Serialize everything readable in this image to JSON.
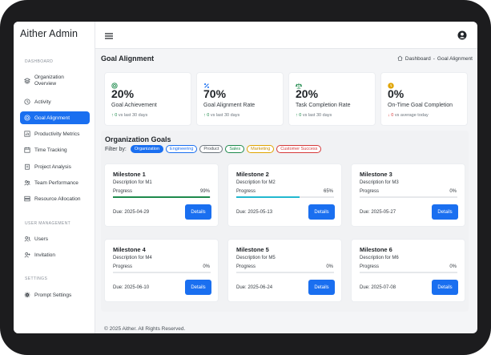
{
  "app": {
    "brand": "Aither Admin"
  },
  "sidebar": {
    "sections": [
      {
        "label": "DASHBOARD"
      },
      {
        "label": "USER MANAGEMENT"
      },
      {
        "label": "SETTINGS"
      }
    ],
    "items": [
      {
        "label": "Organization Overview",
        "icon": "layers-icon"
      },
      {
        "label": "Activity",
        "icon": "clock-icon"
      },
      {
        "label": "Goal Alignment",
        "icon": "target-icon",
        "active": true
      },
      {
        "label": "Productivity Metrics",
        "icon": "bar-chart-icon"
      },
      {
        "label": "Time Tracking",
        "icon": "calendar-icon"
      },
      {
        "label": "Project Analysis",
        "icon": "clipboard-icon"
      },
      {
        "label": "Team Performance",
        "icon": "team-icon"
      },
      {
        "label": "Resource Allocation",
        "icon": "server-icon"
      },
      {
        "label": "Users",
        "icon": "users-icon"
      },
      {
        "label": "Invitation",
        "icon": "user-plus-icon"
      },
      {
        "label": "Prompt Settings",
        "icon": "gear-icon"
      }
    ]
  },
  "header": {
    "menu_icon": "hamburger-icon",
    "user_icon": "user-circle-icon"
  },
  "main": {
    "title": "Goal Alignment",
    "breadcrumb": {
      "home": "Dashboard",
      "separator": "-",
      "current": "Goal Alignment"
    }
  },
  "kpis": [
    {
      "value": "20%",
      "label": "Goal Achievement",
      "trend": "up",
      "delta": "0",
      "sub": "vs last 30 days",
      "icon": "target-icon",
      "color": "#1e8a4c"
    },
    {
      "value": "70%",
      "label": "Goal Alignment Rate",
      "trend": "up",
      "delta": "0",
      "sub": "vs last 30 days",
      "icon": "percent-icon",
      "color": "#1a6ff0"
    },
    {
      "value": "20%",
      "label": "Task Completion Rate",
      "trend": "up",
      "delta": "0",
      "sub": "vs last 30 days",
      "icon": "scale-icon",
      "color": "#1e8a4c"
    },
    {
      "value": "0%",
      "label": "On-Time Goal Completion",
      "trend": "down",
      "delta": "0",
      "sub": "vs average today",
      "icon": "clock-icon",
      "color": "#e0a400"
    }
  ],
  "goals": {
    "title": "Organization Goals",
    "filter_label": "Filter by:",
    "filters": [
      {
        "label": "Organization",
        "color": "#1a6ff0",
        "active": true
      },
      {
        "label": "Engineering",
        "color": "#1a6ff0"
      },
      {
        "label": "Product",
        "color": "#6c757d"
      },
      {
        "label": "Sales",
        "color": "#1e8a4c"
      },
      {
        "label": "Marketing",
        "color": "#e0a400"
      },
      {
        "label": "Customer Success",
        "color": "#d63a3a"
      }
    ],
    "milestones": [
      {
        "title": "Milestone 1",
        "desc": "Description for M1",
        "progress_label": "Progress",
        "pct": "99%",
        "progress": 0.99,
        "bar_color": "#1e8a4c",
        "due": "Due: 2025-04-29",
        "button": "Details"
      },
      {
        "title": "Milestone 2",
        "desc": "Description for M2",
        "progress_label": "Progress",
        "pct": "65%",
        "progress": 0.65,
        "bar_color": "#22b8cf",
        "due": "Due: 2025-05-13",
        "button": "Details"
      },
      {
        "title": "Milestone 3",
        "desc": "Description for M3",
        "progress_label": "Progress",
        "pct": "0%",
        "progress": 0,
        "bar_color": "#1a6ff0",
        "due": "Due: 2025-05-27",
        "button": "Details"
      },
      {
        "title": "Milestone 4",
        "desc": "Description for M4",
        "progress_label": "Progress",
        "pct": "0%",
        "progress": 0,
        "bar_color": "#1a6ff0",
        "due": "Due: 2025-06-10",
        "button": "Details"
      },
      {
        "title": "Milestone 5",
        "desc": "Description for M5",
        "progress_label": "Progress",
        "pct": "0%",
        "progress": 0,
        "bar_color": "#1a6ff0",
        "due": "Due: 2025-06-24",
        "button": "Details"
      },
      {
        "title": "Milestone 6",
        "desc": "Description for M6",
        "progress_label": "Progress",
        "pct": "0%",
        "progress": 0,
        "bar_color": "#1a6ff0",
        "due": "Due: 2025-07-08",
        "button": "Details"
      }
    ]
  },
  "footer": {
    "text": "© 2025 Aither. All Rights Reserved."
  },
  "colors": {
    "accent": "#1a6ff0",
    "success": "#1e8a4c",
    "danger": "#d63a3a",
    "warning": "#e0a400"
  }
}
